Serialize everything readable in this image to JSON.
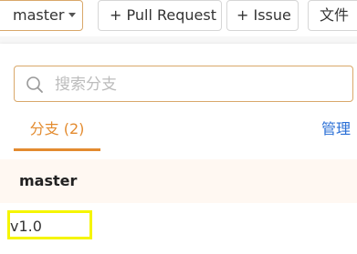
{
  "toolbar": {
    "branch_label": "master",
    "pull_request_label": "+ Pull Request",
    "issue_label": "+ Issue",
    "file_label": "文件"
  },
  "branch_panel": {
    "search_placeholder": "搜索分支",
    "tab_label": "分支 (2)",
    "manage_label": "管理",
    "branches": [
      {
        "name": "master",
        "active": true
      },
      {
        "name": "v1.0",
        "active": false
      }
    ]
  },
  "colors": {
    "accent": "#e38b2f",
    "link": "#2a6fd6",
    "highlight": "#f5f500"
  }
}
